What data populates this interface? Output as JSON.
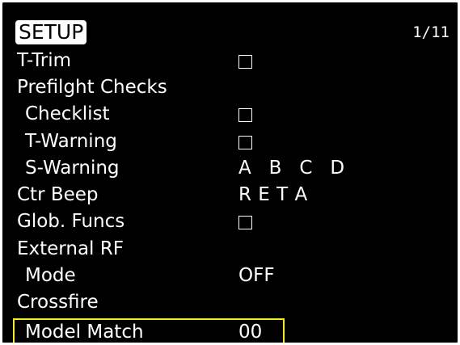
{
  "screen": {
    "title": "SETUP",
    "page": "1/11",
    "highlight_color": "#f4ec27"
  },
  "rows": {
    "t_trim": {
      "label": "T-Trim",
      "value_type": "checkbox",
      "checked": false
    },
    "preflight_checks": {
      "label": "Prefilght Checks"
    },
    "checklist": {
      "label": "Checklist",
      "value_type": "checkbox",
      "checked": false
    },
    "t_warning": {
      "label": "T-Warning",
      "value_type": "checkbox",
      "checked": false
    },
    "s_warning": {
      "label": "S-Warning",
      "value": "A   B   C   D"
    },
    "ctr_beep": {
      "label": "Ctr Beep",
      "value": "R E T A"
    },
    "glob_funcs": {
      "label": "Glob. Funcs",
      "value_type": "checkbox",
      "checked": false
    },
    "external_rf": {
      "label": "External RF"
    },
    "mode": {
      "label": "Mode",
      "value": "OFF"
    },
    "crossfire": {
      "label": "Crossfire"
    },
    "model_match": {
      "label": "Model Match",
      "value": "00",
      "focused": true
    }
  }
}
